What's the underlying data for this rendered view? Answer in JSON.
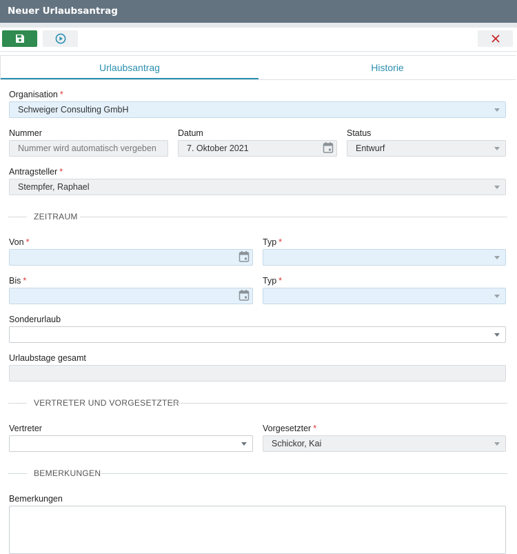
{
  "window": {
    "title": "Neuer Urlaubsantrag"
  },
  "toolbar": {
    "save_icon": "save-icon",
    "run_icon": "play-circle-icon",
    "close_icon": "close-icon"
  },
  "tabs": [
    {
      "label": "Urlaubsantrag",
      "active": true
    },
    {
      "label": "Historie",
      "active": false
    }
  ],
  "form": {
    "organisation": {
      "label": "Organisation",
      "required": "*",
      "value": "Schweiger Consulting GmbH"
    },
    "nummer": {
      "label": "Nummer",
      "placeholder": "Nummer wird automatisch vergeben"
    },
    "datum": {
      "label": "Datum",
      "value": "7. Oktober 2021"
    },
    "status": {
      "label": "Status",
      "value": "Entwurf"
    },
    "antragsteller": {
      "label": "Antragsteller",
      "required": "*",
      "value": "Stempfer, Raphael"
    },
    "section_zeitraum": "ZEITRAUM",
    "von": {
      "label": "Von",
      "required": "*",
      "value": ""
    },
    "typ1": {
      "label": "Typ",
      "required": "*",
      "value": ""
    },
    "bis": {
      "label": "Bis",
      "required": "*",
      "value": ""
    },
    "typ2": {
      "label": "Typ",
      "required": "*",
      "value": ""
    },
    "sonderurlaub": {
      "label": "Sonderurlaub",
      "value": ""
    },
    "urlaubstage": {
      "label": "Urlaubstage gesamt",
      "value": ""
    },
    "section_vertreter": "VERTRETER UND VORGESETZTER",
    "vertreter": {
      "label": "Vertreter",
      "value": ""
    },
    "vorgesetzter": {
      "label": "Vorgesetzter",
      "required": "*",
      "value": "Schickor, Kai"
    },
    "section_bemerkungen": "BEMERKUNGEN",
    "bemerkungen": {
      "label": "Bemerkungen",
      "value": ""
    }
  },
  "colors": {
    "titlebar": "#647380",
    "save_button": "#2f8b4f",
    "tab_accent": "#2a8fb0",
    "required": "#dd3333",
    "close_x": "#c62828"
  }
}
